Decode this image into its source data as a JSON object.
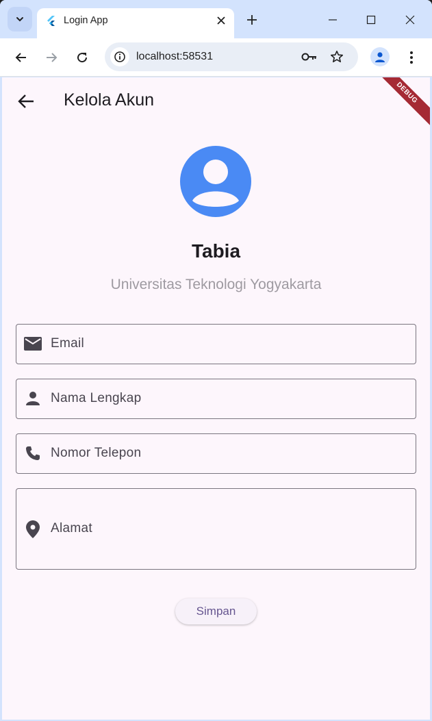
{
  "browser": {
    "tab_title": "Login App",
    "url": "localhost:58531",
    "colors": {
      "frame": "#d3e3fd",
      "tab": "#ffffff",
      "omnibox": "#e9eef6"
    }
  },
  "app": {
    "debug_banner": "DEBUG",
    "title": "Kelola Akun",
    "profile": {
      "name": "Tabia",
      "organization": "Universitas Teknologi Yogyakarta",
      "avatar_color": "#4a8af4"
    },
    "fields": [
      {
        "label": "Email",
        "icon": "mail-icon"
      },
      {
        "label": "Nama Lengkap",
        "icon": "person-icon"
      },
      {
        "label": "Nomor Telepon",
        "icon": "phone-icon"
      },
      {
        "label": "Alamat",
        "icon": "location-pin-icon"
      }
    ],
    "save_label": "Simpan",
    "colors": {
      "background": "#fdf6fc",
      "outline": "#79747e",
      "primary_text": "#65558f"
    }
  }
}
